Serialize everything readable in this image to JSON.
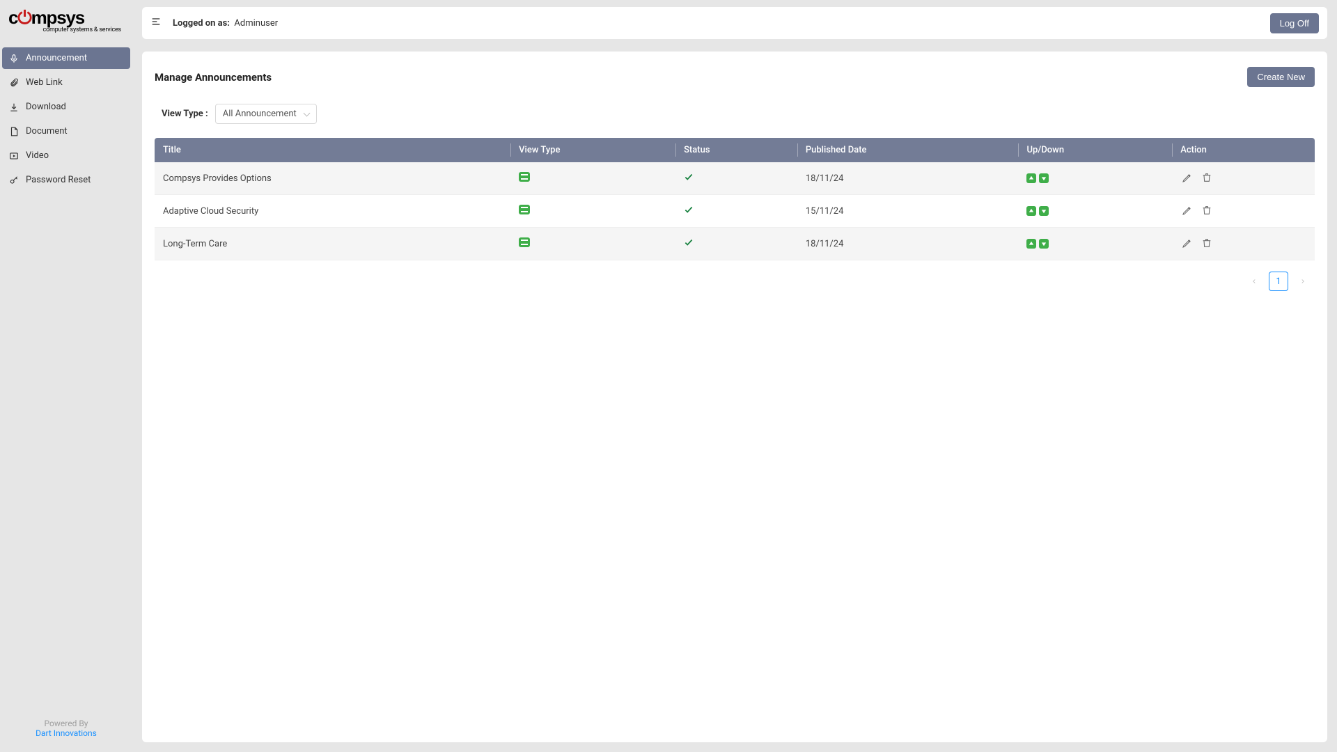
{
  "logo": {
    "brand": "compsys",
    "tagline": "computer systems & services"
  },
  "sidebar": {
    "items": [
      {
        "label": "Announcement",
        "active": true
      },
      {
        "label": "Web Link",
        "active": false
      },
      {
        "label": "Download",
        "active": false
      },
      {
        "label": "Document",
        "active": false
      },
      {
        "label": "Video",
        "active": false
      },
      {
        "label": "Password Reset",
        "active": false
      }
    ],
    "footer": {
      "powered_by": "Powered By",
      "vendor": "Dart Innovations"
    }
  },
  "header": {
    "logged_on_label": "Logged on as:",
    "username": "Adminuser",
    "logoff_label": "Log Off"
  },
  "page": {
    "title": "Manage Announcements",
    "create_label": "Create New",
    "filter_label": "View Type :",
    "filter_value": "All Announcement"
  },
  "table": {
    "columns": [
      "Title",
      "View Type",
      "Status",
      "Published Date",
      "Up/Down",
      "Action"
    ],
    "rows": [
      {
        "title": "Compsys Provides Options",
        "published": "18/11/24"
      },
      {
        "title": "Adaptive Cloud Security",
        "published": "15/11/24"
      },
      {
        "title": "Long-Term Care",
        "published": "18/11/24"
      }
    ]
  },
  "pagination": {
    "current": "1"
  }
}
